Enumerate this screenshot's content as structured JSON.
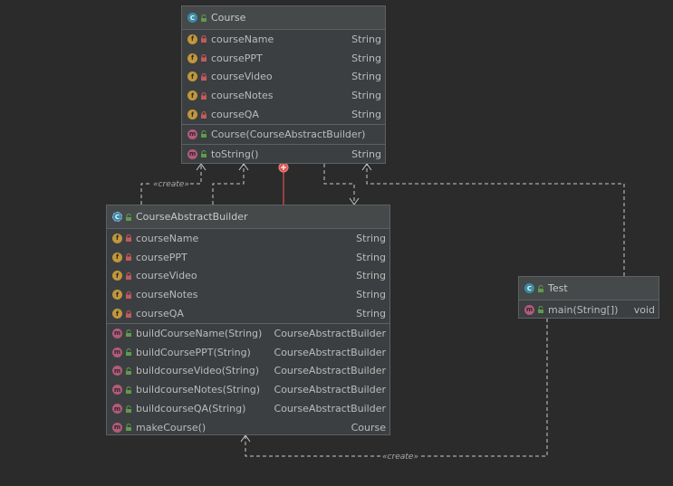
{
  "course": {
    "name": "Course",
    "icon": "class-icon",
    "fields": [
      {
        "name": "courseName",
        "type": "String"
      },
      {
        "name": "coursePPT",
        "type": "String"
      },
      {
        "name": "courseVideo",
        "type": "String"
      },
      {
        "name": "courseNotes",
        "type": "String"
      },
      {
        "name": "courseQA",
        "type": "String"
      }
    ],
    "constructors": [
      {
        "name": "Course(CourseAbstractBuilder)",
        "type": ""
      }
    ],
    "methods": [
      {
        "name": "toString()",
        "type": "String"
      }
    ]
  },
  "builder": {
    "name": "CourseAbstractBuilder",
    "icon": "abstract-class-icon",
    "fields": [
      {
        "name": "courseName",
        "type": "String"
      },
      {
        "name": "coursePPT",
        "type": "String"
      },
      {
        "name": "courseVideo",
        "type": "String"
      },
      {
        "name": "courseNotes",
        "type": "String"
      },
      {
        "name": "courseQA",
        "type": "String"
      }
    ],
    "methods": [
      {
        "name": "buildCourseName(String)",
        "type": "CourseAbstractBuilder"
      },
      {
        "name": "buildCoursePPT(String)",
        "type": "CourseAbstractBuilder"
      },
      {
        "name": "buildcourseVideo(String)",
        "type": "CourseAbstractBuilder"
      },
      {
        "name": "buildcourseNotes(String)",
        "type": "CourseAbstractBuilder"
      },
      {
        "name": "buildcourseQA(String)",
        "type": "CourseAbstractBuilder"
      },
      {
        "name": "makeCourse()",
        "type": "Course"
      }
    ]
  },
  "test": {
    "name": "Test",
    "icon": "test-class-icon",
    "methods": [
      {
        "name": "main(String[])",
        "type": "void"
      }
    ]
  },
  "stereotypes": {
    "create_top": "«create»",
    "create_bottom": "«create»"
  },
  "colors": {
    "background": "#2b2b2b",
    "field_badge": "#c0973b",
    "method_badge": "#b45a7a",
    "class_badge": "#3d8ba5",
    "inner_class_link": "#d9534f",
    "dependency_line": "#c8c8c8"
  }
}
